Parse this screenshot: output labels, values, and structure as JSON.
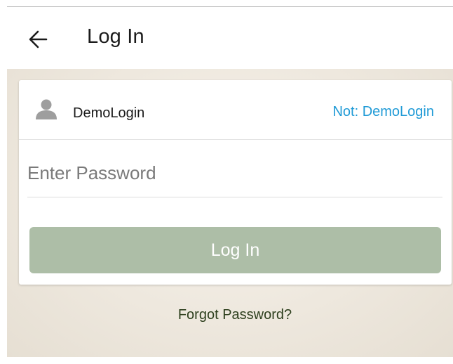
{
  "header": {
    "title": "Log In",
    "back_icon": "arrow-left-icon"
  },
  "account": {
    "avatar_icon": "person-icon",
    "username": "DemoLogin",
    "not_user_link": "Not: DemoLogin"
  },
  "password": {
    "placeholder": "Enter Password",
    "value": ""
  },
  "login_button": {
    "label": "Log In"
  },
  "forgot_password": {
    "label": "Forgot Password?"
  },
  "colors": {
    "accent_link": "#1f9ad6",
    "button": "#adbea7",
    "forgot_link": "#2d3f1d"
  }
}
